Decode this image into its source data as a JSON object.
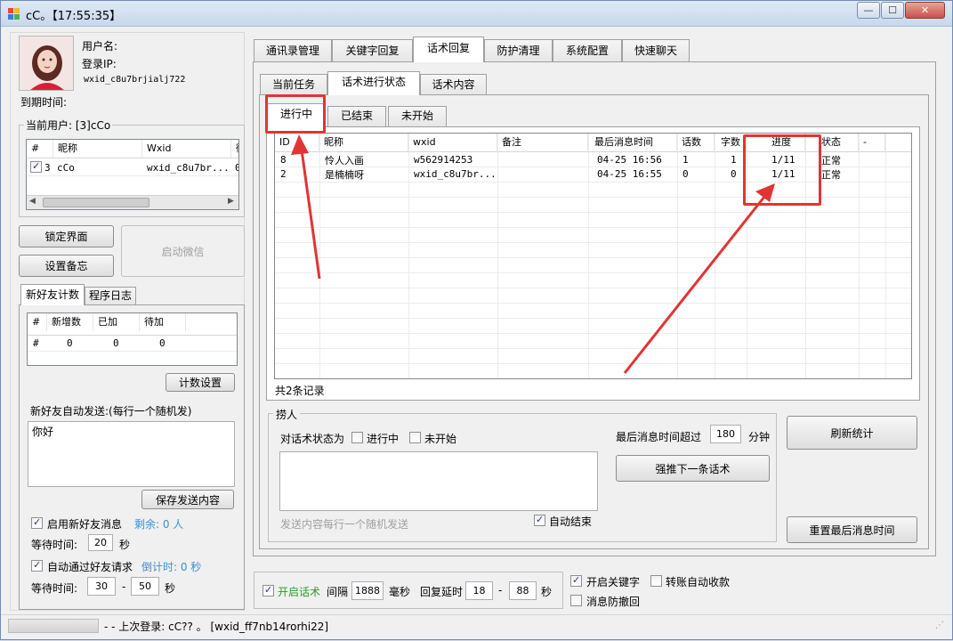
{
  "window": {
    "title": "cC。【17:55:35】",
    "minimize": "—",
    "maximize": "☐",
    "close": "✕"
  },
  "profile": {
    "username_label": "用户名:",
    "login_ip_label": "登录IP:",
    "wxid": "wxid_c8u7brjialj722",
    "expire_label": "到期时间:"
  },
  "current_users": {
    "label": "当前用户: [3]cCo",
    "headers": [
      "#",
      "昵称",
      "Wxid",
      "微"
    ],
    "row": {
      "num": "3",
      "nick": "cCo",
      "wxid": "wxid_c8u7br...",
      "extra": "0",
      "checked": true
    }
  },
  "left_buttons": {
    "lock": "锁定界面",
    "backup": "设置备忘",
    "start_wechat": "启动微信"
  },
  "left_tabs": {
    "new_friend_count": "新好友计数",
    "log": "程序日志"
  },
  "friend_count": {
    "headers": [
      "#",
      "新增数",
      "已加",
      "待加"
    ],
    "row": [
      "#",
      "0",
      "0",
      "0"
    ]
  },
  "count_settings": "计数设置",
  "auto_send": {
    "label": "新好友自动发送:(每行一个随机发)",
    "content": "你好",
    "save": "保存发送内容"
  },
  "enable_new_friend": {
    "label": "启用新好友消息",
    "remaining": "剩余: 0 人",
    "checked": true
  },
  "wait_time_1": {
    "label": "等待时间:",
    "value": "20",
    "unit": "秒"
  },
  "auto_pass": {
    "label": "自动通过好友请求",
    "countdown": "倒计时: 0 秒",
    "checked": true
  },
  "wait_time_2": {
    "label": "等待时间:",
    "min": "30",
    "dash": "-",
    "max": "50",
    "unit": "秒"
  },
  "main_tabs": [
    "通讯录管理",
    "关键字回复",
    "话术回复",
    "防护清理",
    "系统配置",
    "快速聊天"
  ],
  "sub_tabs": [
    "当前任务",
    "话术进行状态",
    "话术内容"
  ],
  "status_tabs": [
    "进行中",
    "已结束",
    "未开始"
  ],
  "table": {
    "headers": [
      "ID",
      "昵称",
      "wxid",
      "备注",
      "最后消息时间",
      "话数",
      "字数",
      "进度",
      "状态",
      "-"
    ],
    "rows": [
      {
        "id": "8",
        "nick": "怜人入画",
        "wxid": "w562914253",
        "remark": "",
        "time": "04-25 16:56",
        "count": "1",
        "chars": "1",
        "progress": "1/11",
        "status": "正常"
      },
      {
        "id": "2",
        "nick": "是楠楠呀",
        "wxid": "wxid_c8u7br...",
        "remark": "",
        "time": "04-25 16:55",
        "count": "0",
        "chars": "0",
        "progress": "1/11",
        "status": "正常"
      }
    ],
    "total": "共2条记录"
  },
  "pull": {
    "group_label": "捞人",
    "state_label": "对话术状态为",
    "in_progress": "进行中",
    "not_started": "未开始",
    "last_msg_label": "最后消息时间超过",
    "last_msg_value": "180",
    "last_msg_unit": "分钟",
    "force_next": "强推下一条话术",
    "placeholder": "发送内容每行一个随机发送",
    "auto_end": "自动结束",
    "auto_end_checked": true
  },
  "right_buttons": {
    "refresh": "刷新统计",
    "reset_time": "重置最后消息时间"
  },
  "bottom": {
    "enable_script": "开启话术",
    "interval_label": "间隔",
    "interval_value": "1888",
    "interval_unit": "毫秒",
    "reply_delay_label": "回复延时",
    "delay_min": "18",
    "dash": "-",
    "delay_max": "88",
    "delay_unit": "秒",
    "enable_keyword": "开启关键字",
    "transfer_auto": "转账自动收款",
    "anti_recall": "消息防撤回"
  },
  "status_bar": {
    "text": "- - 上次登录: cC?? 。 [wxid_ff7nb14rorhi22]"
  },
  "colors": {
    "annotation_red": "#e23434",
    "accent_blue": "#3a8fd0"
  }
}
